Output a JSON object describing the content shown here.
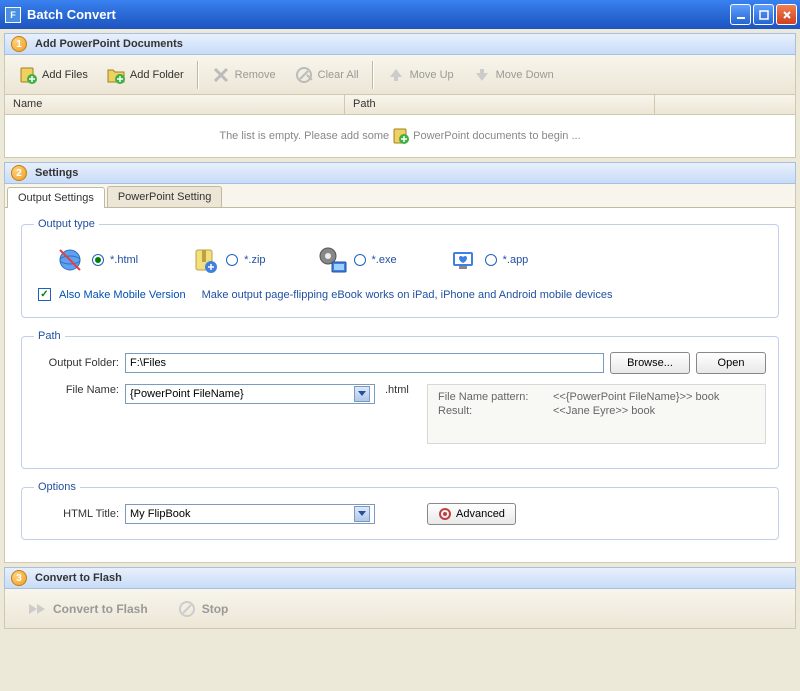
{
  "window": {
    "title": "Batch Convert"
  },
  "sections": {
    "add": {
      "number": "1",
      "title": "Add PowerPoint Documents"
    },
    "settings": {
      "number": "2",
      "title": "Settings"
    },
    "convert": {
      "number": "3",
      "title": "Convert to Flash"
    }
  },
  "toolbar": {
    "add_files": "Add Files",
    "add_folder": "Add Folder",
    "remove": "Remove",
    "clear_all": "Clear All",
    "move_up": "Move Up",
    "move_down": "Move Down"
  },
  "list": {
    "col_name": "Name",
    "col_path": "Path",
    "empty_before": "The list is empty. Please add some ",
    "empty_after": " PowerPoint documents to begin ..."
  },
  "tabs": {
    "output": "Output Settings",
    "ppt": "PowerPoint Setting"
  },
  "output_type": {
    "legend": "Output type",
    "html": "*.html",
    "zip": "*.zip",
    "exe": "*.exe",
    "app": "*.app",
    "mobile_label": "Also Make Mobile Version",
    "mobile_desc": "Make output page-flipping eBook works on iPad, iPhone and Android mobile devices"
  },
  "path": {
    "legend": "Path",
    "output_folder_label": "Output Folder:",
    "output_folder": "F:\\Files",
    "browse": "Browse...",
    "open": "Open",
    "file_name_label": "File Name:",
    "file_name": "{PowerPoint FileName}",
    "ext": ".html",
    "pattern_label": "File Name pattern:",
    "pattern_value": "<<{PowerPoint FileName}>> book",
    "result_label": "Result:",
    "result_value": "<<Jane Eyre>> book"
  },
  "options": {
    "legend": "Options",
    "html_title_label": "HTML Title:",
    "html_title": "My FlipBook",
    "advanced": "Advanced"
  },
  "footer": {
    "convert": "Convert to Flash",
    "stop": "Stop"
  }
}
